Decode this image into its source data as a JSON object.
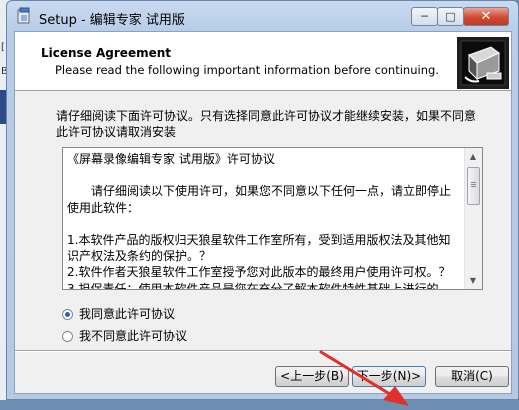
{
  "window": {
    "title": "Setup - 编辑专家 试用版",
    "min_glyph": "─",
    "max_glyph": "□",
    "close_glyph": "✕"
  },
  "header": {
    "title": "License Agreement",
    "subtitle": "Please read the following important information before continuing."
  },
  "instruction": "请仔细阅读下面许可协议。只有选择同意此许可协议才能继续安装，如果不同意此许可协议请取消安装",
  "license": {
    "lines": [
      "《屏幕录像编辑专家 试用版》许可协议",
      "",
      "　　请仔细阅读以下使用许可，如果您不同意以下任何一点，请立即停止使用此软件：",
      "",
      "1.本软件产品的版权归天狼星软件工作室所有，受到适用版权法及其他知识产权法及条约的保护。？",
      "2.软件作者天狼星软件工作室授予您对此版本的最终用户使用许可权。？",
      "3.担保责任：使用本软件产品是您在充分了解本软件特性基础上进行的，"
    ],
    "scroll_up_glyph": "▲",
    "scroll_down_glyph": "▼"
  },
  "options": {
    "accept": "我同意此许可协议",
    "decline": "我不同意此许可协议",
    "selected": "accept"
  },
  "buttons": {
    "back": "<上一步(B)",
    "next": "下一步(N)>",
    "cancel": "取消(C)"
  },
  "colors": {
    "arrow": "#e0302a",
    "title_bar": "#b8cde8",
    "close_button": "#c94530"
  },
  "icons": {
    "app": "setup-icon",
    "header": "computer-install-icon",
    "annotation": "red-arrow-icon"
  }
}
